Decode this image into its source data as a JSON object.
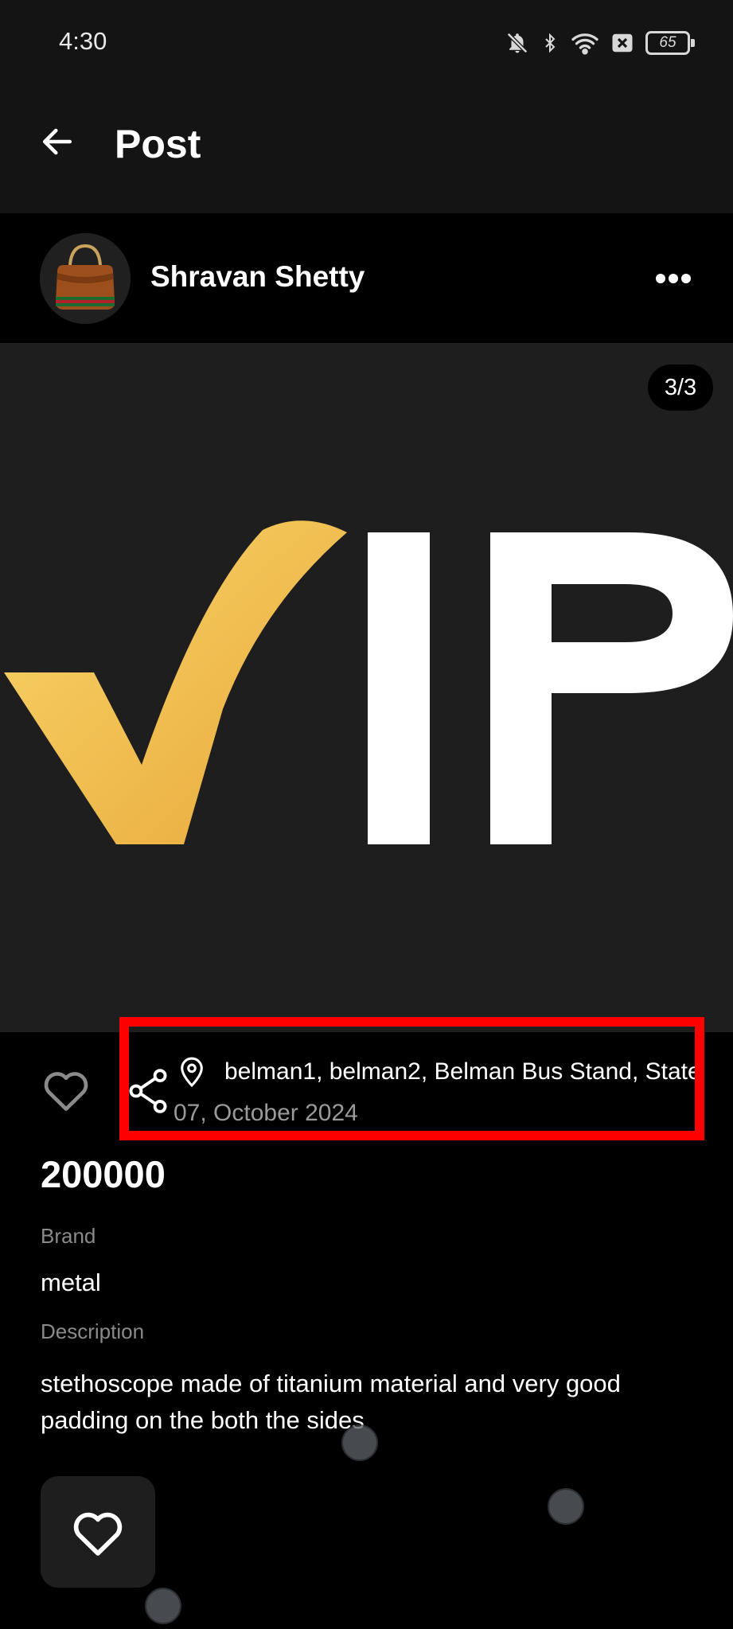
{
  "status_bar": {
    "time": "4:30",
    "battery": "65",
    "icons": [
      "bell-off-icon",
      "bluetooth-icon",
      "wifi-icon",
      "sim-x-icon",
      "battery-icon"
    ]
  },
  "header": {
    "title": "Post",
    "back_icon": "arrow-left-icon"
  },
  "post": {
    "author": "Shravan Shetty",
    "image_counter": "3/3",
    "image_logo": {
      "text_part": "IP",
      "check_color": "#f2b63a",
      "letter_color": "#ffffff"
    },
    "location": "belman1, belman2, Belman Bus Stand, State",
    "date": "07, October 2024",
    "price": "200000",
    "brand_label": "Brand",
    "brand_value": "metal",
    "description_label": "Description",
    "description_value": "stethoscope made of titanium material and very good padding on the both the sides"
  },
  "colors": {
    "background": "#000000",
    "surface": "#1e1e1e",
    "header": "#141414",
    "muted_text": "#8a8a8a",
    "highlight": "#ff0000"
  }
}
